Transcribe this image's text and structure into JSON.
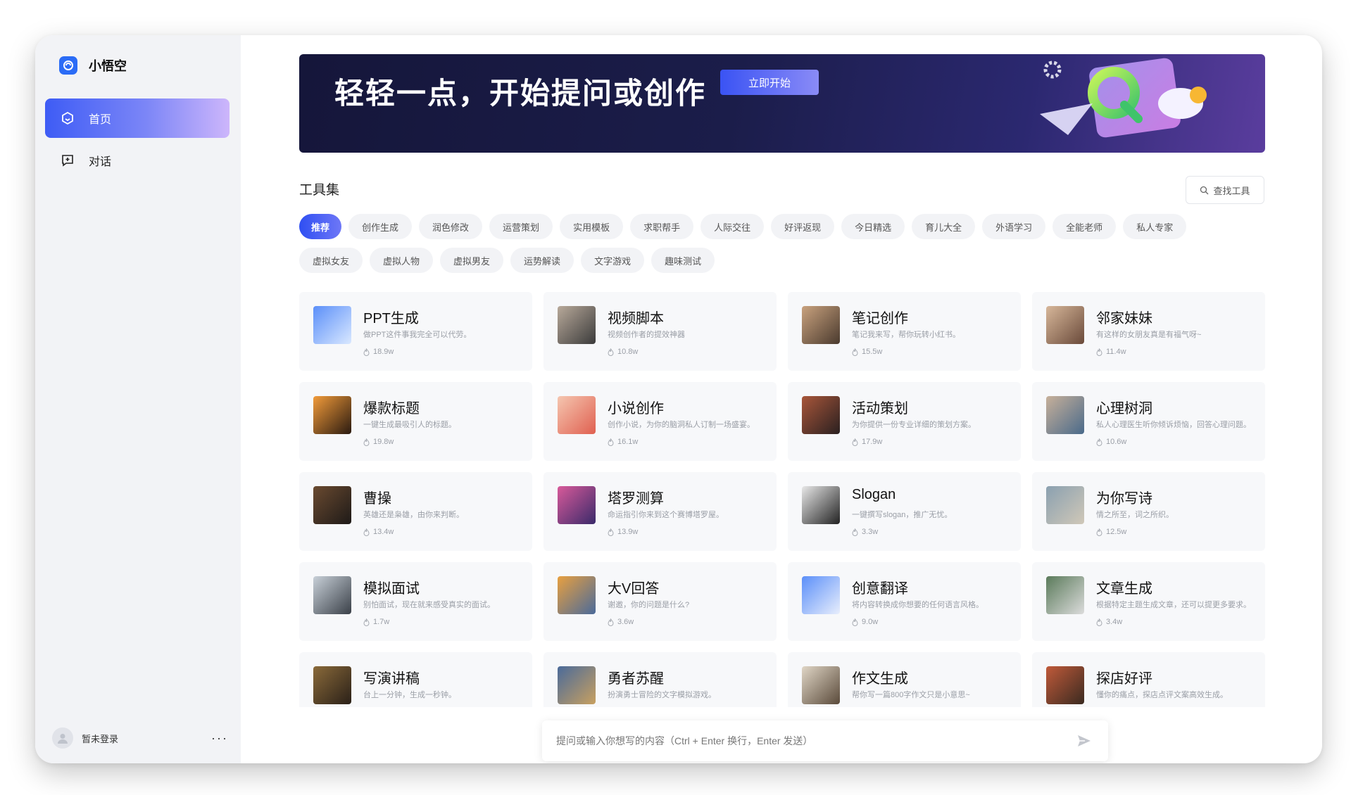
{
  "app": {
    "name": "小悟空"
  },
  "sidebar": {
    "items": [
      {
        "label": "首页",
        "icon": "home-hexagon-icon",
        "active": true
      },
      {
        "label": "对话",
        "icon": "chat-add-icon",
        "active": false
      }
    ],
    "user": {
      "name": "暂未登录",
      "more": "···"
    }
  },
  "banner": {
    "title": "轻轻一点，开始提问或创作",
    "button": "立即开始"
  },
  "tools": {
    "section_title": "工具集",
    "search_label": "查找工具",
    "tags_row1": [
      "推荐",
      "创作生成",
      "润色修改",
      "运营策划",
      "实用模板",
      "求职帮手",
      "人际交往",
      "好评返现",
      "今日精选",
      "育儿大全",
      "外语学习",
      "全能老师",
      "私人专家"
    ],
    "tags_row2": [
      "虚拟女友",
      "虚拟人物",
      "虚拟男友",
      "运势解读",
      "文字游戏",
      "趣味测试"
    ],
    "cards": [
      {
        "title": "PPT生成",
        "desc": "做PPT这件事我完全可以代劳。",
        "count": "18.9w"
      },
      {
        "title": "视频脚本",
        "desc": "视频创作者的提效神器",
        "count": "10.8w"
      },
      {
        "title": "笔记创作",
        "desc": "笔记我来写，帮你玩转小红书。",
        "count": "15.5w"
      },
      {
        "title": "邻家妹妹",
        "desc": "有这样的女朋友真是有福气呀~",
        "count": "11.4w"
      },
      {
        "title": "爆款标题",
        "desc": "一键生成最吸引人的标题。",
        "count": "19.8w"
      },
      {
        "title": "小说创作",
        "desc": "创作小说，为你的脑洞私人订制一场盛宴。",
        "count": "16.1w"
      },
      {
        "title": "活动策划",
        "desc": "为你提供一份专业详细的策划方案。",
        "count": "17.9w"
      },
      {
        "title": "心理树洞",
        "desc": "私人心理医生听你倾诉烦恼，回答心理问题。",
        "count": "10.6w"
      },
      {
        "title": "曹操",
        "desc": "英雄还是枭雄，由你来判断。",
        "count": "13.4w"
      },
      {
        "title": "塔罗测算",
        "desc": "命运指引你来到这个赛博塔罗屋。",
        "count": "13.9w"
      },
      {
        "title": "Slogan",
        "desc": "一键撰写slogan，推广无忧。",
        "count": "3.3w"
      },
      {
        "title": "为你写诗",
        "desc": "情之所至，词之所织。",
        "count": "12.5w"
      },
      {
        "title": "模拟面试",
        "desc": "别怕面试，现在就来感受真实的面试。",
        "count": "1.7w"
      },
      {
        "title": "大V回答",
        "desc": "谢邀，你的问题是什么?",
        "count": "3.6w"
      },
      {
        "title": "创意翻译",
        "desc": "将内容转换成你想要的任何语言风格。",
        "count": "9.0w"
      },
      {
        "title": "文章生成",
        "desc": "根据特定主题生成文章，还可以提更多要求。",
        "count": "3.4w"
      },
      {
        "title": "写演讲稿",
        "desc": "台上一分钟，生成一秒钟。",
        "count": ""
      },
      {
        "title": "勇者苏醒",
        "desc": "扮演勇士冒险的文字模拟游戏。",
        "count": ""
      },
      {
        "title": "作文生成",
        "desc": "帮你写一篇800字作文只是小意思~",
        "count": ""
      },
      {
        "title": "探店好评",
        "desc": "懂你的痛点，探店点评文案高效生成。",
        "count": ""
      }
    ]
  },
  "chat": {
    "placeholder": "提问或输入你想写的内容（Ctrl + Enter 换行，Enter 发送）"
  },
  "colors": {
    "accent": "#2f4ff2",
    "sidebar_bg": "#f2f3f6",
    "card_bg": "#f7f8fa"
  },
  "thumb_colors": [
    [
      "#5b8ff9",
      "#d9e8ff"
    ],
    [
      "#b8a99a",
      "#3b3b3b"
    ],
    [
      "#c9a27e",
      "#4a3a2e"
    ],
    [
      "#d7b79a",
      "#6a4a3a"
    ],
    [
      "#f29b3a",
      "#2a1a10"
    ],
    [
      "#f5c6b0",
      "#e06050"
    ],
    [
      "#a8563a",
      "#2a2020"
    ],
    [
      "#c7b09a",
      "#4a6a8a"
    ],
    [
      "#6a4a30",
      "#1e1a18"
    ],
    [
      "#d85a9a",
      "#3a2a6a"
    ],
    [
      "#e8e8e8",
      "#222222"
    ],
    [
      "#8aa0b0",
      "#d0c8b8"
    ],
    [
      "#c8d0d8",
      "#3a4048"
    ],
    [
      "#e8a040",
      "#4a6a9a"
    ],
    [
      "#5b8ff9",
      "#e8eefc"
    ],
    [
      "#5a7a5a",
      "#dcdcdc"
    ],
    [
      "#8a6a3a",
      "#2a2018"
    ],
    [
      "#4a6a9a",
      "#c8a060"
    ],
    [
      "#e0d6c6",
      "#5a4a3a"
    ],
    [
      "#c05a3a",
      "#3a2a20"
    ]
  ]
}
